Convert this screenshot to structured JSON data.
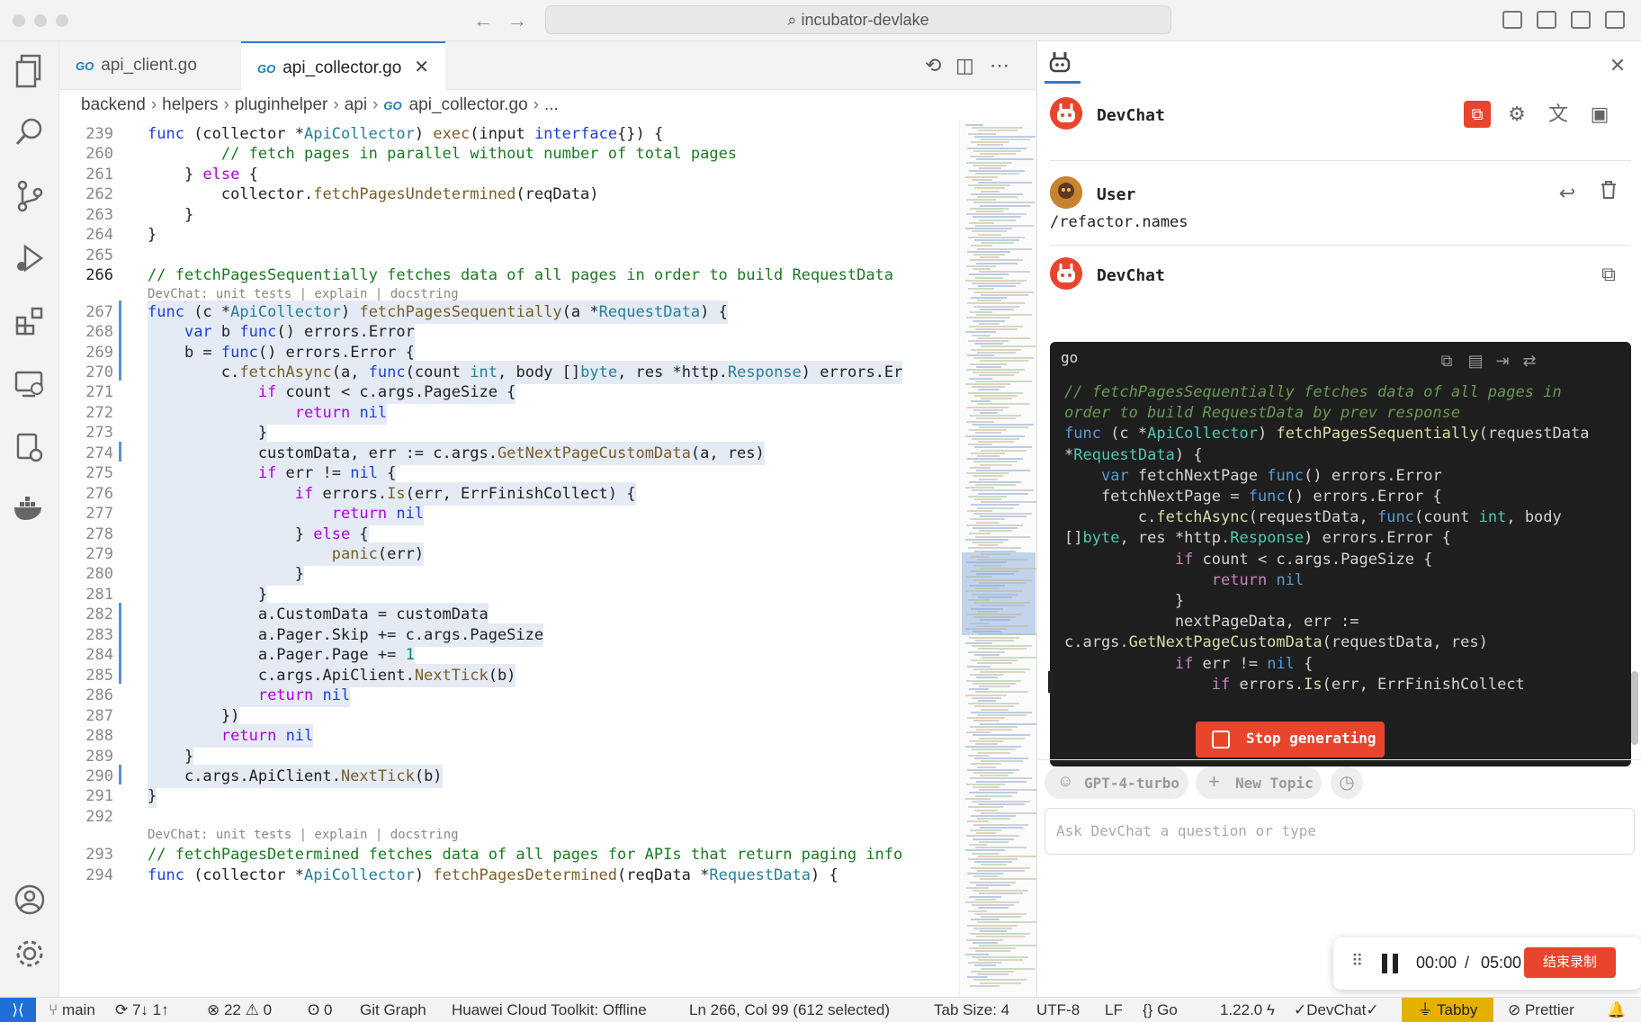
{
  "window": {
    "search_text": "incubator-devlake"
  },
  "tabs": [
    {
      "label": "api_client.go",
      "badge": "GO"
    },
    {
      "label": "api_collector.go",
      "badge": "GO",
      "active": true
    }
  ],
  "breadcrumb": [
    "backend",
    "helpers",
    "pluginhelper",
    "api",
    "api_collector.go",
    "..."
  ],
  "code": {
    "current_line": "266",
    "lens_text": "DevChat: unit tests | explain | docstring",
    "lines": [
      {
        "n": "239",
        "t": "func (collector *ApiCollector) exec(input interface{}) {"
      },
      {
        "n": "260",
        "t": "        // fetch pages in parallel without number of total pages"
      },
      {
        "n": "261",
        "t": "    } else {"
      },
      {
        "n": "262",
        "t": "        collector.fetchPagesUndetermined(reqData)"
      },
      {
        "n": "263",
        "t": "    }"
      },
      {
        "n": "264",
        "t": "}"
      },
      {
        "n": "265",
        "t": ""
      },
      {
        "n": "266",
        "t": "// fetchPagesSequentially fetches data of all pages in order to build RequestData"
      },
      {
        "n": "267",
        "t": "func (c *ApiCollector) fetchPagesSequentially(a *RequestData) {"
      },
      {
        "n": "268",
        "t": "    var b func() errors.Error"
      },
      {
        "n": "269",
        "t": "    b = func() errors.Error {"
      },
      {
        "n": "270",
        "t": "        c.fetchAsync(a, func(count int, body []byte, res *http.Response) errors.Er"
      },
      {
        "n": "271",
        "t": "            if count < c.args.PageSize {"
      },
      {
        "n": "272",
        "t": "                return nil"
      },
      {
        "n": "273",
        "t": "            }"
      },
      {
        "n": "274",
        "t": "            customData, err := c.args.GetNextPageCustomData(a, res)"
      },
      {
        "n": "275",
        "t": "            if err != nil {"
      },
      {
        "n": "276",
        "t": "                if errors.Is(err, ErrFinishCollect) {"
      },
      {
        "n": "277",
        "t": "                    return nil"
      },
      {
        "n": "278",
        "t": "                } else {"
      },
      {
        "n": "279",
        "t": "                    panic(err)"
      },
      {
        "n": "280",
        "t": "                }"
      },
      {
        "n": "281",
        "t": "            }"
      },
      {
        "n": "282",
        "t": "            a.CustomData = customData"
      },
      {
        "n": "283",
        "t": "            a.Pager.Skip += c.args.PageSize"
      },
      {
        "n": "284",
        "t": "            a.Pager.Page += 1"
      },
      {
        "n": "285",
        "t": "            c.args.ApiClient.NextTick(b)"
      },
      {
        "n": "286",
        "t": "            return nil"
      },
      {
        "n": "287",
        "t": "        })"
      },
      {
        "n": "288",
        "t": "        return nil"
      },
      {
        "n": "289",
        "t": "    }"
      },
      {
        "n": "290",
        "t": "    c.args.ApiClient.NextTick(b)"
      },
      {
        "n": "291",
        "t": "}"
      },
      {
        "n": "292",
        "t": ""
      },
      {
        "n": "293",
        "t": "// fetchPagesDetermined fetches data of all pages for APIs that return paging info"
      },
      {
        "n": "294",
        "t": "func (collector *ApiCollector) fetchPagesDetermined(reqData *RequestData) {"
      }
    ]
  },
  "chat": {
    "app_name": "DevChat",
    "user_label": "User",
    "user_message": "/refactor.names",
    "bot_label": "DevChat",
    "code_lang": "go",
    "code_lines": [
      "// fetchPagesSequentially fetches data of all pages in",
      "order to build RequestData by prev response",
      "func (c *ApiCollector) fetchPagesSequentially(requestData",
      "*RequestData) {",
      "    var fetchNextPage func() errors.Error",
      "    fetchNextPage = func() errors.Error {",
      "        c.fetchAsync(requestData, func(count int, body",
      "[]byte, res *http.Response) errors.Error {",
      "            if count < c.args.PageSize {",
      "                return nil",
      "            }",
      "            nextPageData, err :=",
      "c.args.GetNextPageCustomData(requestData, res)",
      "            if err != nil {",
      "                if errors.Is(err, ErrFinishCollect"
    ],
    "stop_label": "Stop generating",
    "model_label": "GPT-4-turbo",
    "new_topic_label": "New Topic",
    "input_placeholder": "Ask DevChat a question or type",
    "accent": "#e8452c"
  },
  "recording": {
    "time": "00:00",
    "sep": "/",
    "total": "05:00",
    "end_label": "结束录制"
  },
  "status": {
    "branch": "main",
    "sync": "7↓ 1↑",
    "errors": "22",
    "warnings": "0",
    "ports": "0",
    "git_graph": "Git Graph",
    "huawei": "Huawei Cloud Toolkit: Offline",
    "position": "Ln 266, Col 99 (612 selected)",
    "tab_size": "Tab Size: 4",
    "encoding": "UTF-8",
    "eol": "LF",
    "language": "Go",
    "go_version": "1.22.0",
    "devchat": "DevChat",
    "tabby": "Tabby",
    "prettier": "Prettier",
    "accent": "#1f6fd6"
  }
}
